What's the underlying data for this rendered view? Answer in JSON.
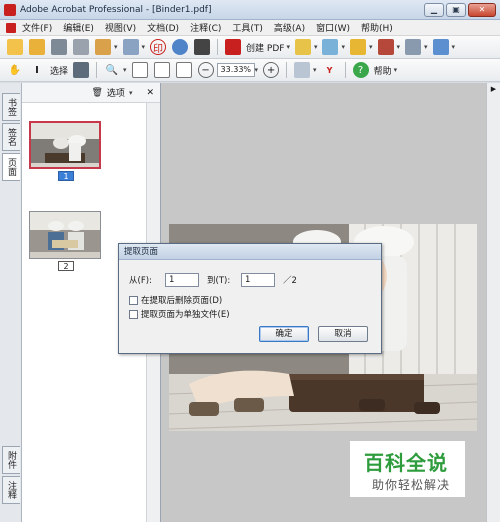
{
  "window": {
    "title": "Adobe Acrobat Professional - [Binder1.pdf]",
    "minimize": "▁",
    "restore": "▣",
    "close": "✕"
  },
  "menu": [
    "文件(F)",
    "编辑(E)",
    "视图(V)",
    "文档(D)",
    "注释(C)",
    "工具(T)",
    "高级(A)",
    "窗口(W)",
    "帮助(H)"
  ],
  "toolbar": {
    "create_pdf": "创建 PDF",
    "select": "选择",
    "zoom": "33.33%",
    "help": "帮助"
  },
  "sidetabs": {
    "bookmarks": "书签",
    "signatures": "签名",
    "pages": "页面",
    "attachments": "附件",
    "comments": "注释"
  },
  "panel": {
    "options": "选项",
    "close": "✕",
    "pages": [
      {
        "label": "1",
        "selected": true
      },
      {
        "label": "2",
        "selected": false
      }
    ]
  },
  "dialog": {
    "title": "提取页面",
    "from_label": "从(F):",
    "from_value": "1",
    "to_label": "到(T):",
    "to_value": "1",
    "total": "／2",
    "opt_delete": "在提取后删除页面(D)",
    "opt_separate": "提取页面为单独文件(E)",
    "ok": "确定",
    "cancel": "取消"
  },
  "watermark": {
    "main": "百科全说",
    "sub": "助你轻松解决"
  },
  "colors": {
    "accent": "#3b7fd7",
    "watermark_green": "#2e9c3d",
    "acrobat_red": "#c8201e"
  }
}
